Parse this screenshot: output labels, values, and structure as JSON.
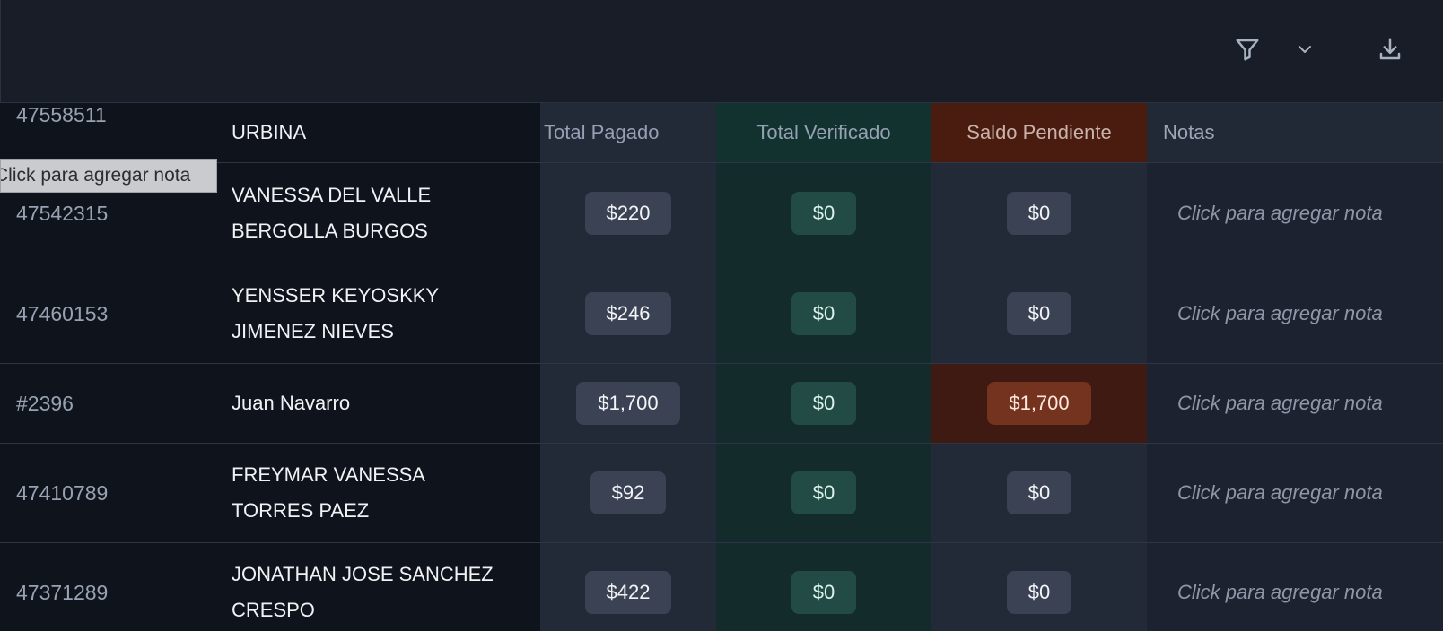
{
  "toolbar": {
    "filter_icon": "filter-icon",
    "dropdown_icon": "chevron-down-icon",
    "download_icon": "download-icon"
  },
  "columns": {
    "total_pagado": "Total Pagado",
    "total_verificado": "Total Verificado",
    "saldo_pendiente": "Saldo Pendiente",
    "notas": "Notas"
  },
  "partial_row": {
    "id": "47558511",
    "name": "URBINA"
  },
  "tooltip": "Click para agregar nota",
  "rows": [
    {
      "id": "47542315",
      "name_line1": "VANESSA DEL VALLE",
      "name_line2": "BERGOLLA BURGOS",
      "total_pagado": "$220",
      "total_verificado": "$0",
      "saldo_pendiente": "$0",
      "nota": "Click para agregar nota"
    },
    {
      "id": "47460153",
      "name_line1": "YENSSER KEYOSKKY",
      "name_line2": "JIMENEZ NIEVES",
      "total_pagado": "$246",
      "total_verificado": "$0",
      "saldo_pendiente": "$0",
      "nota": "Click para agregar nota"
    },
    {
      "id": "#2396",
      "name_line1": "Juan Navarro",
      "name_line2": "",
      "total_pagado": "$1,700",
      "total_verificado": "$0",
      "saldo_pendiente": "$1,700",
      "nota": "Click para agregar nota"
    },
    {
      "id": "47410789",
      "name_line1": "FREYMAR VANESSA",
      "name_line2": "TORRES PAEZ",
      "total_pagado": "$92",
      "total_verificado": "$0",
      "saldo_pendiente": "$0",
      "nota": "Click para agregar nota"
    },
    {
      "id": "47371289",
      "name_line1": "JONATHAN JOSE SANCHEZ",
      "name_line2": "CRESPO",
      "total_pagado": "$422",
      "total_verificado": "$0",
      "saldo_pendiente": "$0",
      "nota": "Click para agregar nota"
    }
  ],
  "colors": {
    "pending_highlight": "#3f1a12",
    "pending_pill": "#73331f",
    "verified_column": "#142b2c",
    "verified_pill": "#234b45"
  }
}
